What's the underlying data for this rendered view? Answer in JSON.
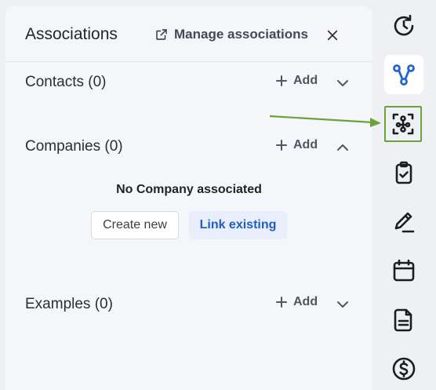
{
  "panel": {
    "title": "Associations",
    "manage_label": "Manage associations"
  },
  "sections": [
    {
      "label": "Contacts (0)",
      "add_label": "Add",
      "expanded": false
    },
    {
      "label": "Companies (0)",
      "add_label": "Add",
      "expanded": true
    },
    {
      "label": "Examples (0)",
      "add_label": "Add",
      "expanded": false
    }
  ],
  "companies_empty": {
    "message": "No Company associated",
    "create_label": "Create new",
    "link_label": "Link existing"
  },
  "rail": {
    "icons": [
      "clock-history-icon",
      "associations-icon",
      "connections-icon",
      "clipboard-check-icon",
      "pen-signature-icon",
      "calendar-icon",
      "document-icon",
      "dollar-icon"
    ],
    "active": "associations-icon",
    "highlighted": "connections-icon"
  },
  "colors": {
    "accent": "#1f5fbf",
    "highlight": "#6ba33a"
  }
}
